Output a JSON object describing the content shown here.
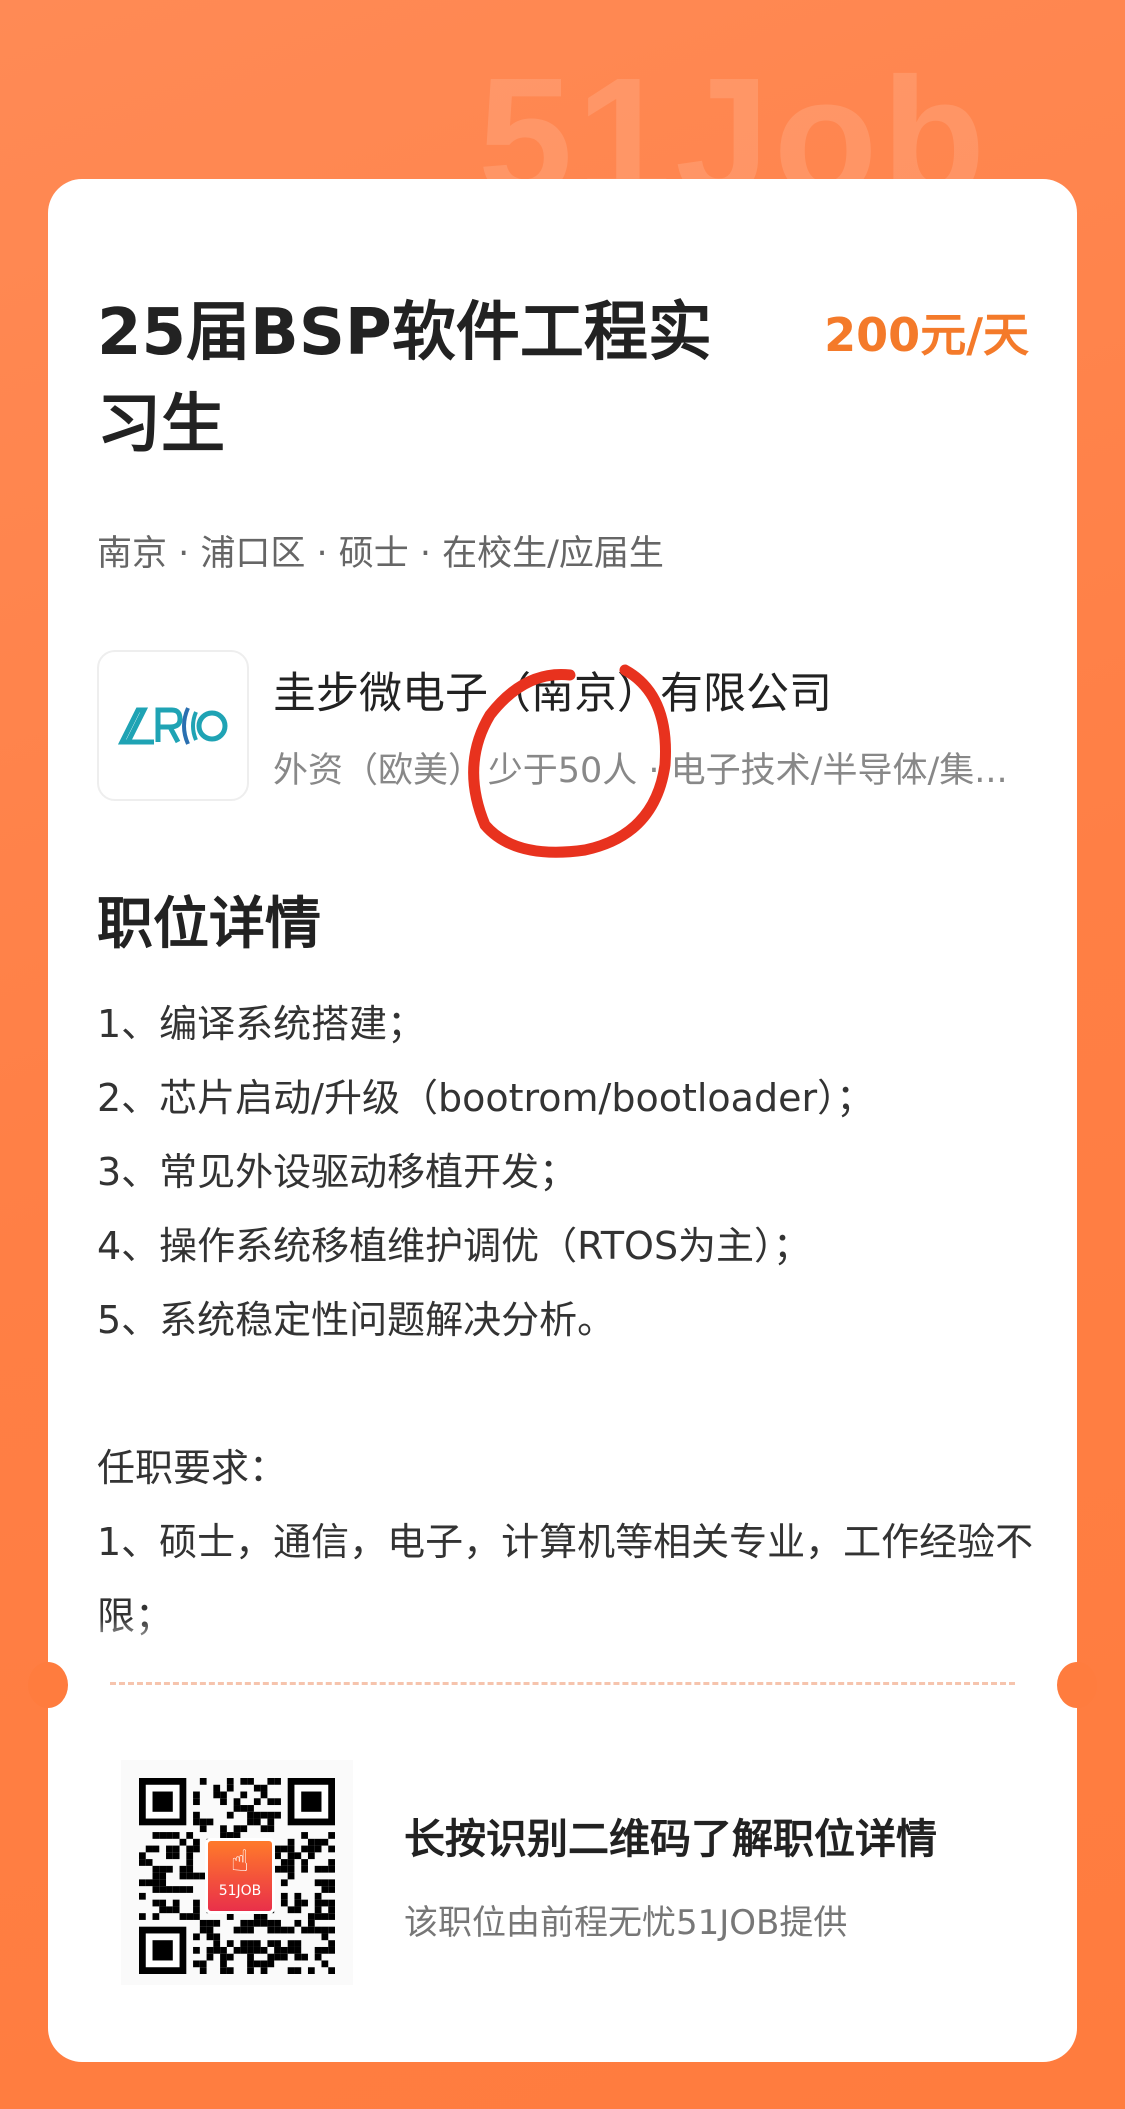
{
  "watermark": "51Job",
  "job": {
    "title": "25届BSP软件工程实习生",
    "salary": "200元/天",
    "meta": "南京 · 浦口区 · 硕士 · 在校生/应届生"
  },
  "company": {
    "name": "圭步微电子（南京）有限公司",
    "details": "外资（欧美）· 少于50人 · 电子技术/半导体/集...",
    "logo_text": "ARIO",
    "logo_color": "#1fa3b4"
  },
  "section": {
    "heading": "职位详情",
    "lines": [
      "1、编译系统搭建；",
      "2、芯片启动/升级（bootrom/bootloader）；",
      "3、常见外设驱动移植开发；",
      "4、操作系统移植维护调优（RTOS为主）；",
      "5、系统稳定性问题解决分析。",
      "",
      "任职要求：",
      "1、硕士，通信，电子，计算机等相关专业，工作经验不限；"
    ]
  },
  "qr": {
    "badge": "51JOB",
    "prompt": "长按识别二维码了解职位详情",
    "provider": "该职位由前程无忧51JOB提供"
  },
  "colors": {
    "accent": "#f47a2a",
    "background": "#ff7c3e",
    "annotation": "#e8321e"
  }
}
